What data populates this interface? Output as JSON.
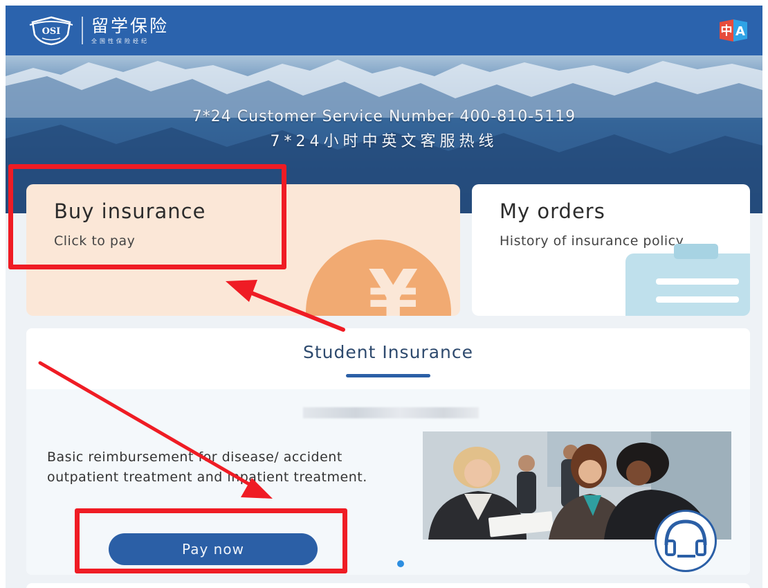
{
  "header": {
    "brand_cn": "留学保险",
    "brand_sub": "全国性保险经纪",
    "logo_text": "OSI",
    "lang_toggle_icon": "language-switch-icon"
  },
  "banner": {
    "service_en": "7*24 Customer Service Number 400-810-5119",
    "service_cn": "7*24小时中英文客服热线"
  },
  "cards": {
    "buy": {
      "title": "Buy insurance",
      "subtitle": "Click to pay",
      "icon": "yen-icon"
    },
    "orders": {
      "title": "My orders",
      "subtitle": "History of insurance policy",
      "icon": "clipboard-icon"
    }
  },
  "student_insurance": {
    "section_title": "Student Insurance",
    "product": {
      "description": "Basic reimbursement for disease/ accident outpatient treatment and inpatient treatment.",
      "button_label": "Pay now"
    }
  },
  "support": {
    "icon": "headset-icon"
  },
  "colors": {
    "header_blue": "#2b63ad",
    "button_blue": "#2b5fa6",
    "card_peach": "#fbe7d7",
    "yen_orange": "#f1aa72",
    "annotation_red": "#ef1c24"
  }
}
